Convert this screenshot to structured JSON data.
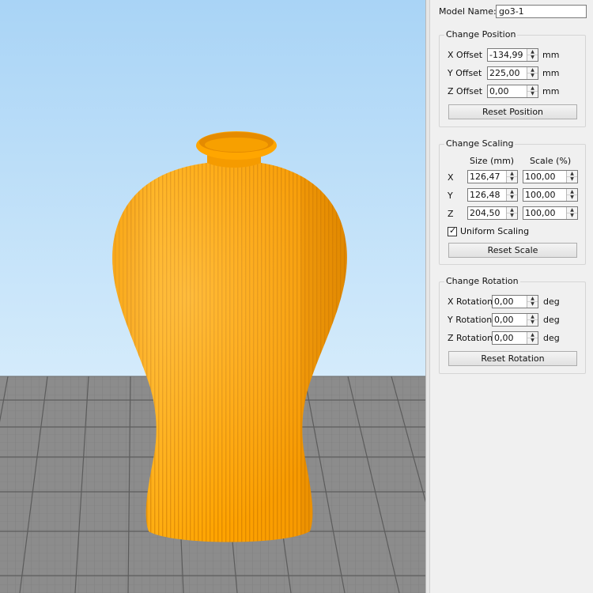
{
  "model": {
    "name_label": "Model Name:",
    "name_value": "go3-1"
  },
  "position": {
    "title": "Change Position",
    "rows": [
      {
        "label": "X Offset",
        "value": "-134,99",
        "unit": "mm"
      },
      {
        "label": "Y Offset",
        "value": "225,00",
        "unit": "mm"
      },
      {
        "label": "Z Offset",
        "value": "0,00",
        "unit": "mm"
      }
    ],
    "reset_label": "Reset Position"
  },
  "scaling": {
    "title": "Change Scaling",
    "col_size": "Size (mm)",
    "col_scale": "Scale (%)",
    "rows": [
      {
        "axis": "X",
        "size": "126,47",
        "scale": "100,00"
      },
      {
        "axis": "Y",
        "size": "126,48",
        "scale": "100,00"
      },
      {
        "axis": "Z",
        "size": "204,50",
        "scale": "100,00"
      }
    ],
    "uniform_label": "Uniform Scaling",
    "uniform_checked": true,
    "reset_label": "Reset Scale"
  },
  "rotation": {
    "title": "Change Rotation",
    "rows": [
      {
        "label": "X Rotation",
        "value": "0,00",
        "unit": "deg"
      },
      {
        "label": "Y Rotation",
        "value": "0,00",
        "unit": "deg"
      },
      {
        "label": "Z Rotation",
        "value": "0,00",
        "unit": "deg"
      }
    ],
    "reset_label": "Reset Rotation"
  },
  "icons": {
    "spin_up": "▲",
    "spin_down": "▼",
    "check": "✓"
  },
  "colors": {
    "sky_top": "#a9d4f6",
    "sky_bottom": "#d4ebfb",
    "floor": "#8a8a8a",
    "model": "#ffa200"
  }
}
